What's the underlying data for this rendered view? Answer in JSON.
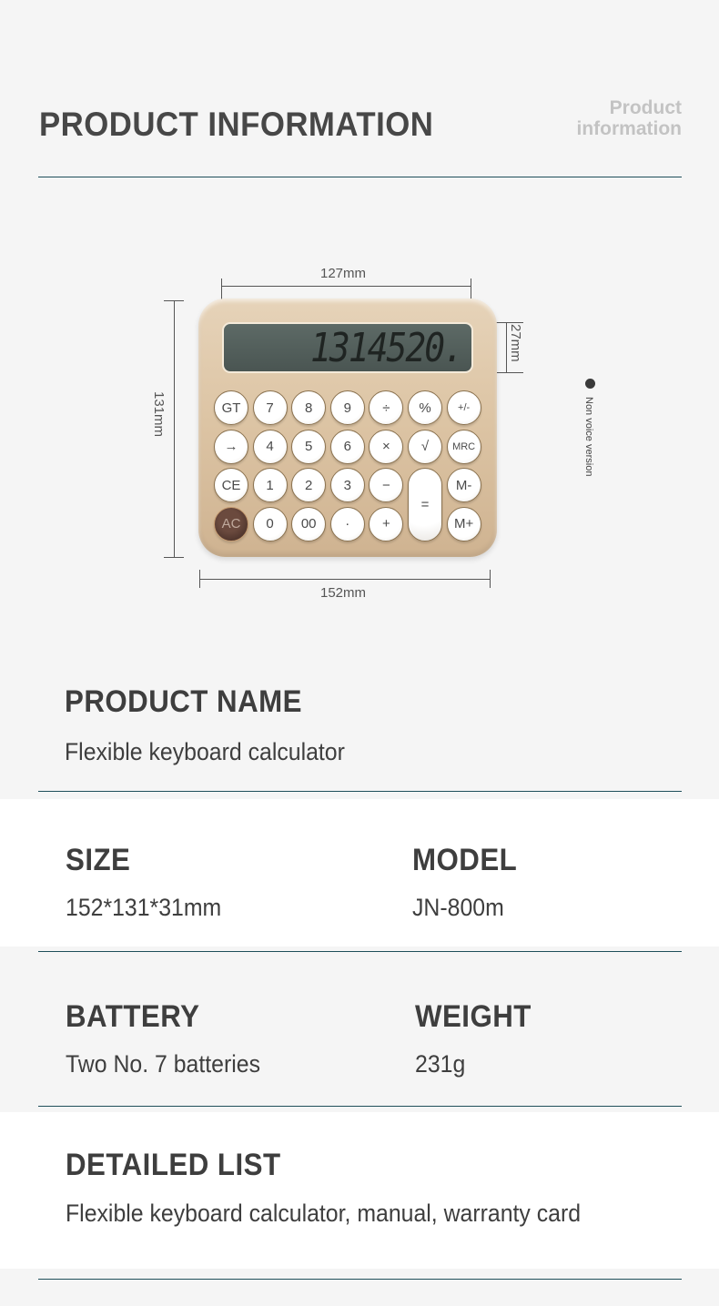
{
  "header": {
    "title": "PRODUCT INFORMATION",
    "subtitle_line1": "Product",
    "subtitle_line2": "information"
  },
  "diagram": {
    "screen_width_label": "127mm",
    "screen_height_label": "27mm",
    "height_label": "131mm",
    "width_label": "152mm",
    "display_value": "1314520.",
    "version_note": "Non voice version",
    "keys": [
      [
        "GT",
        "7",
        "8",
        "9",
        "÷",
        "%",
        "+/-"
      ],
      [
        "→",
        "4",
        "5",
        "6",
        "×",
        "√",
        "MRC"
      ],
      [
        "CE",
        "1",
        "2",
        "3",
        "−",
        "=",
        "M-"
      ],
      [
        "AC",
        "0",
        "00",
        "·",
        "+",
        "",
        "M+"
      ]
    ]
  },
  "specs": {
    "product_name": {
      "label": "PRODUCT NAME",
      "value": "Flexible keyboard calculator"
    },
    "size": {
      "label": "SIZE",
      "value": "152*131*31mm"
    },
    "model": {
      "label": "MODEL",
      "value": "JN-800m"
    },
    "battery": {
      "label": "BATTERY",
      "value": "Two No. 7 batteries"
    },
    "weight": {
      "label": "WEIGHT",
      "value": "231g"
    },
    "detailed_list": {
      "label": "DETAILED LIST",
      "value": "Flexible keyboard calculator, manual, warranty card"
    }
  }
}
